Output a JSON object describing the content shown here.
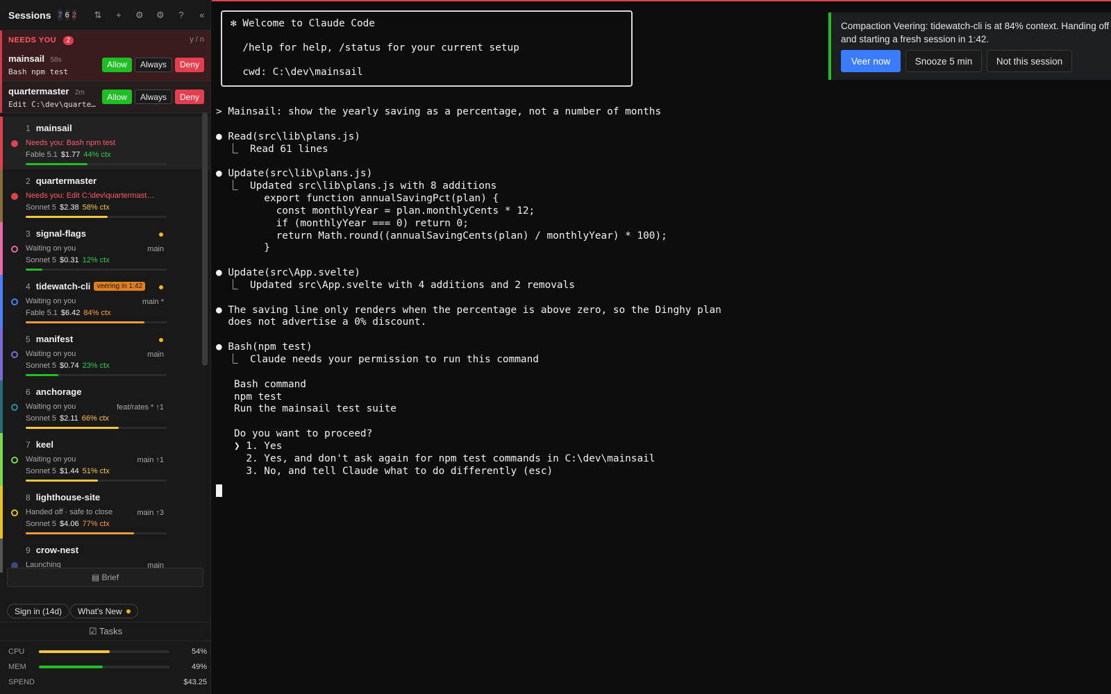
{
  "sidebar": {
    "title": "Sessions",
    "counts": [
      "7",
      "6",
      "2"
    ],
    "header_icons": [
      "⇅",
      "+",
      "⚙",
      "⚙",
      "?",
      "«"
    ],
    "header_icon_names": [
      "sort-icon",
      "add-icon",
      "palette-icon",
      "settings-icon",
      "help-icon",
      "collapse-icon"
    ],
    "needs": {
      "label": "NEEDS YOU",
      "count": "2",
      "hint": "y / n",
      "requests": [
        {
          "name": "mainsail",
          "age": "58s",
          "cmd": "Bash npm test"
        },
        {
          "name": "quartermaster",
          "age": "2m",
          "cmd": "Edit C:\\dev\\quartermaster\\src\\ledger.js"
        }
      ],
      "allow": "Allow",
      "always": "Always",
      "deny": "Deny"
    },
    "sessions": [
      {
        "num": "1",
        "name": "mainsail",
        "status": "Needs you: Bash npm test",
        "status_color": "red",
        "branch": "",
        "model": "Fable 5.1",
        "cost": "$1.77",
        "ctx": "44% ctx",
        "ctx_color": "green",
        "ctx_fraction": 0.44,
        "accent": "#e0414f",
        "dot_color": "#e0414f",
        "dot_style": "filled",
        "yellow_dot": false,
        "veer": ""
      },
      {
        "num": "2",
        "name": "quartermaster",
        "status": "Needs you: Edit C:\\dev\\quartermaster\\src\\ledger.js",
        "status_color": "red",
        "branch": "",
        "model": "Sonnet 5",
        "cost": "$2.38",
        "ctx": "58% ctx",
        "ctx_color": "yellow",
        "ctx_fraction": 0.58,
        "accent": "#8a6a3a",
        "dot_color": "#e0414f",
        "dot_style": "filled",
        "yellow_dot": false,
        "veer": ""
      },
      {
        "num": "3",
        "name": "signal-flags",
        "status": "Waiting on you",
        "status_color": "grey",
        "branch": "main",
        "model": "Sonnet 5",
        "cost": "$0.31",
        "ctx": "12% ctx",
        "ctx_color": "green",
        "ctx_fraction": 0.12,
        "accent": "#e86aa8",
        "dot_color": "#e86aa8",
        "dot_style": "ring",
        "yellow_dot": true,
        "veer": ""
      },
      {
        "num": "4",
        "name": "tidewatch-cli",
        "status": "Waiting on you",
        "status_color": "grey",
        "branch": "main *",
        "model": "Fable 5.1",
        "cost": "$6.42",
        "ctx": "84% ctx",
        "ctx_color": "orange",
        "ctx_fraction": 0.84,
        "accent": "#4a7dff",
        "dot_color": "#4a7dff",
        "dot_style": "ring",
        "yellow_dot": true,
        "veer": "veering in 1:42"
      },
      {
        "num": "5",
        "name": "manifest",
        "status": "Waiting on you",
        "status_color": "grey",
        "branch": "main",
        "model": "Sonnet 5",
        "cost": "$0.74",
        "ctx": "23% ctx",
        "ctx_color": "green",
        "ctx_fraction": 0.23,
        "accent": "#7a6ad8",
        "dot_color": "#7a6ad8",
        "dot_style": "ring",
        "yellow_dot": true,
        "veer": ""
      },
      {
        "num": "6",
        "name": "anchorage",
        "status": "Waiting on you",
        "status_color": "grey",
        "branch": "feat/rates * ↑1",
        "model": "Sonnet 5",
        "cost": "$2.11",
        "ctx": "66% ctx",
        "ctx_color": "yellow",
        "ctx_fraction": 0.66,
        "accent": "#2b6a7a",
        "dot_color": "#2e8aa8",
        "dot_style": "ring",
        "yellow_dot": false,
        "veer": ""
      },
      {
        "num": "7",
        "name": "keel",
        "status": "Waiting on you",
        "status_color": "grey",
        "branch": "main ↑1",
        "model": "Sonnet 5",
        "cost": "$1.44",
        "ctx": "51% ctx",
        "ctx_color": "yellow",
        "ctx_fraction": 0.51,
        "accent": "#7ad84a",
        "dot_color": "#7ad84a",
        "dot_style": "ring",
        "yellow_dot": false,
        "veer": ""
      },
      {
        "num": "8",
        "name": "lighthouse-site",
        "status": "Handed off · safe to close",
        "status_color": "grey",
        "branch": "main ↑3",
        "model": "Sonnet 5",
        "cost": "$4.06",
        "ctx": "77% ctx",
        "ctx_color": "orange",
        "ctx_fraction": 0.77,
        "accent": "#e8c21f",
        "dot_color": "#e8c21f",
        "dot_style": "ring",
        "yellow_dot": false,
        "veer": ""
      },
      {
        "num": "9",
        "name": "crow-nest",
        "status": "Launching",
        "status_color": "grey",
        "branch": "main",
        "model": "",
        "cost": "",
        "ctx": "",
        "ctx_color": "green",
        "ctx_fraction": 0,
        "accent": "#555555",
        "dot_color": "#3a4a7a",
        "dot_style": "filled",
        "yellow_dot": false,
        "veer": ""
      }
    ],
    "brief_label": "▤ Brief",
    "sign_in": "Sign in (14d)",
    "whats_new": "What's New",
    "tasks": "☑ Tasks",
    "stats": [
      {
        "label": "CPU",
        "value": "54%",
        "fraction": 0.54,
        "color": "#f5c542"
      },
      {
        "label": "MEM",
        "value": "49%",
        "fraction": 0.49,
        "color": "#1fbf24"
      },
      {
        "label": "SPEND",
        "value": "$43.25"
      }
    ]
  },
  "terminal": {
    "accent_color": "#e0414f",
    "welcome": [
      "✻ Welcome to Claude Code",
      "",
      "  /help for help, /status for your current setup",
      "",
      "  cwd: C:\\dev\\mainsail"
    ],
    "lines": [
      "> Mainsail: show the yearly saving as a percentage, not a number of months",
      "",
      "● Read(src\\lib\\plans.js)",
      "  ⎿  Read 61 lines",
      "",
      "● Update(src\\lib\\plans.js)",
      "  ⎿  Updated src\\lib\\plans.js with 8 additions",
      "        export function annualSavingPct(plan) {",
      "          const monthlyYear = plan.monthlyCents * 12;",
      "          if (monthlyYear === 0) return 0;",
      "          return Math.round((annualSavingCents(plan) / monthlyYear) * 100);",
      "        }",
      "",
      "● Update(src\\App.svelte)",
      "  ⎿  Updated src\\App.svelte with 4 additions and 2 removals",
      "",
      "● The saving line only renders when the percentage is above zero, so the Dinghy plan",
      "  does not advertise a 0% discount.",
      "",
      "● Bash(npm test)",
      "  ⎿  Claude needs your permission to run this command",
      "",
      "   Bash command",
      "   npm test",
      "   Run the mainsail test suite",
      "",
      "   Do you want to proceed?",
      "   ❯ 1. Yes",
      "     2. Yes, and don't ask again for npm test commands in C:\\dev\\mainsail",
      "     3. No, and tell Claude what to do differently (esc)"
    ]
  },
  "toast": {
    "message": "Compaction Veering: tidewatch-cli is at 84% context. Handing off and starting a fresh session in 1:42.",
    "accent_color": "#1fbf24",
    "veer_now": "Veer now",
    "snooze": "Snooze 5 min",
    "not_this": "Not this session"
  }
}
